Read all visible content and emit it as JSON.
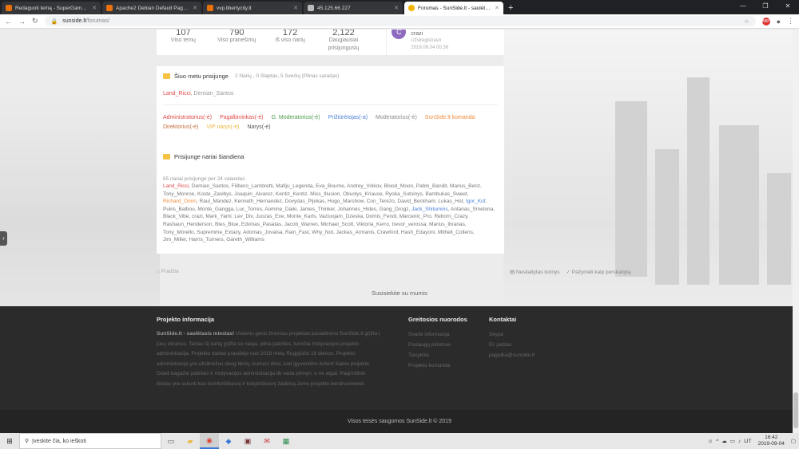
{
  "browser": {
    "tabs": [
      {
        "title": "Redaguoti temą - SuperGames.lt",
        "active": false
      },
      {
        "title": "Apache2 Debian Default Page: It",
        "active": false
      },
      {
        "title": "vvp.libertycity.lt",
        "active": false
      },
      {
        "title": "45.125.66.227",
        "active": false
      },
      {
        "title": "Forumas - SunSide.lt - saulėtasis",
        "active": true
      }
    ],
    "new_tab": "+",
    "url_host": "sunside.lt",
    "url_path": "/forumas/"
  },
  "stats": [
    {
      "value": "107",
      "label": "Viso temų"
    },
    {
      "value": "790",
      "label": "Viso pranešimų"
    },
    {
      "value": "172",
      "label": "Iš viso narių"
    },
    {
      "value": "2,122",
      "label": "Daugiausiai prisijungusių"
    }
  ],
  "newest_member": {
    "initial": "C",
    "name": "crazi",
    "status": "Užsiregistravo",
    "date": "2019.09.04 00:36"
  },
  "online": {
    "title": "Šiuo metu prisijunge",
    "summary": "2 Narių , 0 Slaptas, 5 Svečių (Pilnas sarašas)",
    "users": [
      {
        "name": "Land_Ricci",
        "color": "red"
      },
      {
        "name": "Demian_Santos",
        "color": "gray"
      }
    ],
    "separator": ", ",
    "legend": [
      {
        "label": "Administratorius(-ė)",
        "cls": "c-admin"
      },
      {
        "label": "Pagalbininkas(-ė)",
        "cls": "c-help"
      },
      {
        "label": "G. Moderatorius(-ė)",
        "cls": "c-gmod"
      },
      {
        "label": "Prižiūrėtojas(-a)",
        "cls": "c-watch"
      },
      {
        "label": "Moderatorius(-ė)",
        "cls": "c-mod"
      },
      {
        "label": "SunSide.lt komanda",
        "cls": "c-sun"
      },
      {
        "label": "Direktorius(-ė)",
        "cls": "c-dir"
      },
      {
        "label": "VIP narys(-ė)",
        "cls": "c-vip"
      },
      {
        "label": "Narys(-ė)",
        "cls": "c-mem"
      }
    ]
  },
  "today": {
    "title": "Prisijunge nariai šiandiena",
    "count_text": "65 nariai prisijunge per 24 valandas",
    "names_html_parts": [
      {
        "t": "Land_Ricci",
        "c": "r"
      },
      {
        "t": ", Demian_Santos, Filibero_Lambretti, Mafiju_Legenda, Eva_Bourne, Andrey_Volkov, Blood_Moon, Pablo_Bandit, Marius_Beriz, Tony_Monroe, Koste_Zasibys, Joaquin_Alvarez, Kentiz_Kentiz, Miss_Illusion, Obuolys_Kriause, Ryoka_Sutsinys, Bambukas_Sweet, ",
        "c": ""
      },
      {
        "t": "Richard_Orion",
        "c": "o"
      },
      {
        "t": ", Raul_Mandez, Kenneth_Hernandez, Dovydas_Pijokas, Hugo_Marshow, Con_Terezo, David_Beckham, Lukas_Hot, ",
        "c": ""
      },
      {
        "t": "Igor_Kof",
        "c": "b"
      },
      {
        "t": ", Pukis_Balbou, Monte_Gangga, Luc_Torres, Aomine_Daiki, James_Thinker, Johannes_Hides, Gang_Drogz, ",
        "c": ""
      },
      {
        "t": "Jack_Shitumins",
        "c": "b"
      },
      {
        "t": ", Antanas_Smetona, Black_Vibe, crazi, Mark_Yami, Lev_Div, Juozas_Exe, Monte_Karls, Vaziuojam_Dzeska, Domis_Fendi, Marcenic_Pro, Reborn_Crazy, Rashaun_Henderson, Bles_Blue, Edvinas_Pasatas, Jacob_Warren, Michael_Scott, Viktoria_Kerro, trevor_verossa, Marius_Ibranas, Tony_Morello, Supremme_Extazy, Adomas_Jovaisa, Rain_Fast, Why_Not, Jackas_Armanis, Crawford, Hash_Edayoni, Mithell_Collens, Jim_Miller, Harris_Turners, Gareth_Williams",
        "c": ""
      }
    ]
  },
  "breadcrumb": "Pradžia",
  "actions": {
    "unread": "Neskaitytas turinys",
    "mark_read": "Pažymėti kaip perskaitytą"
  },
  "contact": "Susisiekite su mumis",
  "footer": {
    "project_title": "Projekto informacija",
    "project_bold": "SunSide.lt - saulėtasis miestas!",
    "project_text": " Visiems gerai žinomas projektas pavadinimu SunSide.lt grįžta į jūsų ekranus. Tačiau šį kartą grįžta su nauja, pilna patirties, turinčia motyvacijos projekto administracija. Projekto darbai prasidėjo nuo 2019 metų Rugpjūčio 19 dienos. Projekto administracija yra užsibrėžus daug tikslų, kuriuos tikisi, kad įgyvendins būtent šiame projekte. Dideli bagažai patirties ir motyvacijos administracija tik veda pirmyn, o ne atgal. Pagrindinis tikslas yra sukurti kuo komfortiškesnį ir kokybiškesnį žaidimą Jums projekto bendruomenei.",
    "links_title": "Greitosios nuorodos",
    "links": [
      "Svarbi informacija",
      "Paslaugų pirkimas",
      "Taisyklės",
      "Projekto komanda"
    ],
    "contacts_title": "Kontaktai",
    "contacts": [
      "Skype",
      "El. paštas",
      "pagalba@sunside.lt"
    ],
    "copyright": "Visos teisės saugomos SunSide.lt © 2019"
  },
  "taskbar": {
    "search_placeholder": "Įveskite čia, ko ieškoti",
    "lang": "LIT",
    "time": "16:42",
    "date": "2019-09-04"
  }
}
